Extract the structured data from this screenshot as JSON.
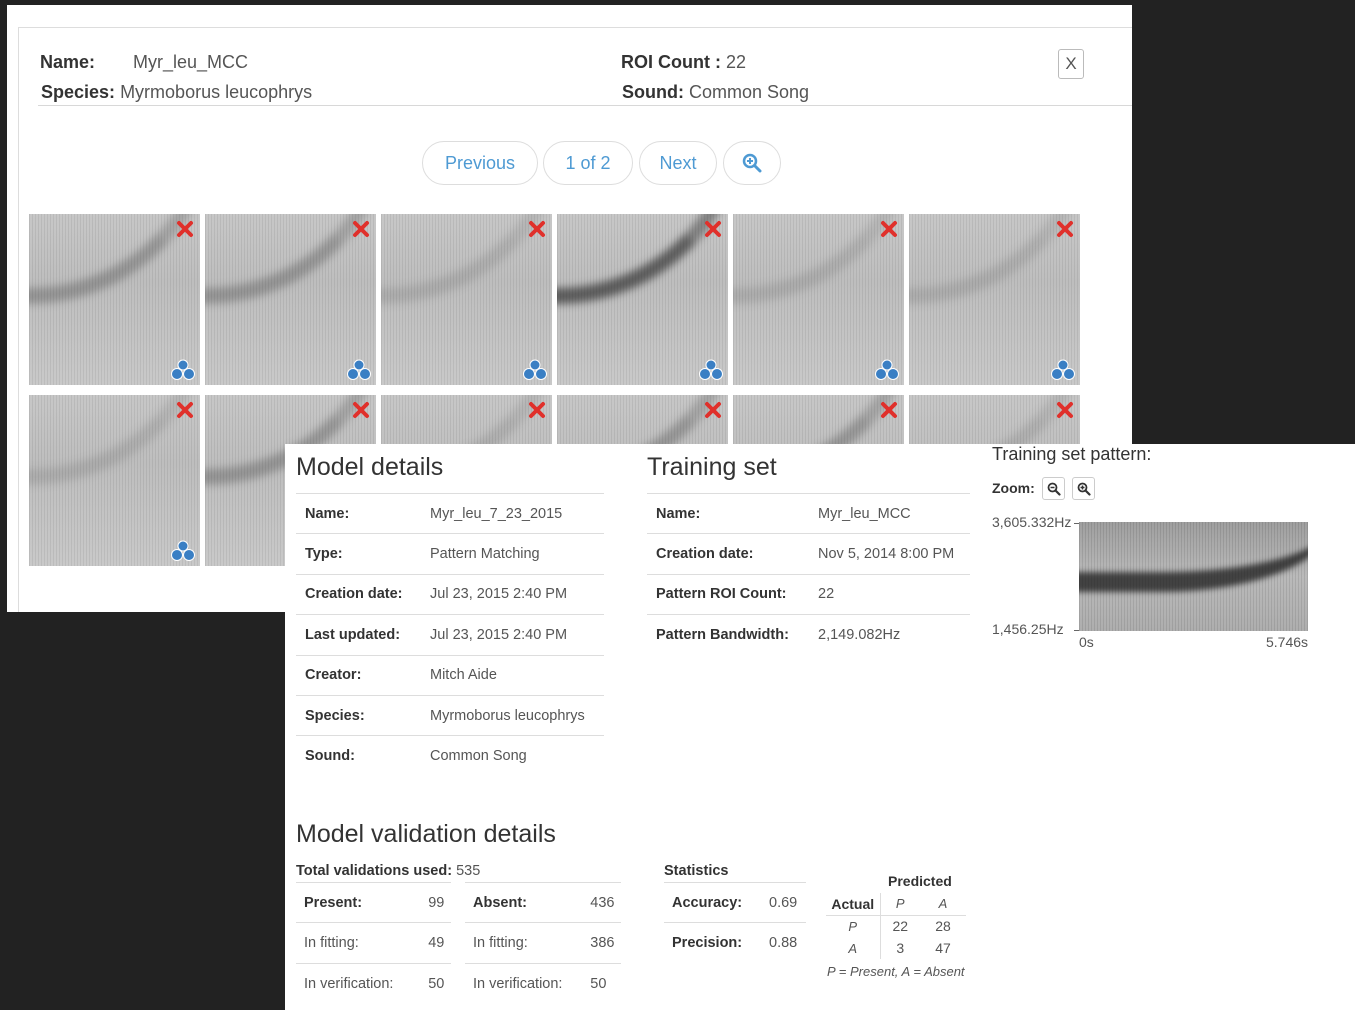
{
  "roi_dialog": {
    "name_label": "Name:",
    "name_value": "Myr_leu_MCC",
    "species_label": "Species:",
    "species_value": "Myrmoborus leucophrys",
    "roi_count_label": "ROI Count :",
    "roi_count_value": "22",
    "sound_label": "Sound:",
    "sound_value": "Common Song",
    "close_label": "X",
    "pager": {
      "previous": "Previous",
      "page": "1 of 2",
      "next": "Next"
    }
  },
  "model_details": {
    "title": "Model details",
    "rows": [
      {
        "key": "Name:",
        "value": "Myr_leu_7_23_2015"
      },
      {
        "key": "Type:",
        "value": "Pattern Matching"
      },
      {
        "key": "Creation date:",
        "value": "Jul 23, 2015 2:40 PM"
      },
      {
        "key": "Last updated:",
        "value": "Jul 23, 2015 2:40 PM"
      },
      {
        "key": "Creator:",
        "value": "Mitch Aide"
      },
      {
        "key": "Species:",
        "value": "Myrmoborus leucophrys"
      },
      {
        "key": "Sound:",
        "value": "Common Song"
      }
    ]
  },
  "training_set": {
    "title": "Training set",
    "rows": [
      {
        "key": "Name:",
        "value": "Myr_leu_MCC"
      },
      {
        "key": "Creation date:",
        "value": "Nov 5, 2014 8:00 PM"
      },
      {
        "key": "Pattern ROI Count:",
        "value": "22"
      },
      {
        "key": "Pattern Bandwidth:",
        "value": "2,149.082Hz"
      }
    ]
  },
  "training_pattern": {
    "title": "Training set pattern:",
    "zoom_label": "Zoom:",
    "freq_max": "3,605.332Hz",
    "freq_min": "1,456.25Hz",
    "time_min": "0s",
    "time_max": "5.746s"
  },
  "validation": {
    "title": "Model validation details",
    "total_label": "Total validations used:",
    "total_value": "535",
    "present": [
      {
        "key": "Present:",
        "value": "99"
      },
      {
        "key": "In fitting:",
        "value": "49"
      },
      {
        "key": "In verification:",
        "value": "50"
      }
    ],
    "absent": [
      {
        "key": "Absent:",
        "value": "436"
      },
      {
        "key": "In fitting:",
        "value": "386"
      },
      {
        "key": "In verification:",
        "value": "50"
      }
    ],
    "statistics_label": "Statistics",
    "statistics": [
      {
        "key": "Accuracy:",
        "value": "0.69"
      },
      {
        "key": "Precision:",
        "value": "0.88"
      }
    ],
    "confusion": {
      "predicted_label": "Predicted",
      "actual_label": "Actual",
      "p": "P",
      "a": "A",
      "pp": "22",
      "pa": "28",
      "ap": "3",
      "aa": "47",
      "legend": "P = Present, A = Absent"
    }
  },
  "colors": {
    "link": "#4e9ad3",
    "remove_red": "#e0302b",
    "cluster_blue": "#3a7fc4"
  }
}
